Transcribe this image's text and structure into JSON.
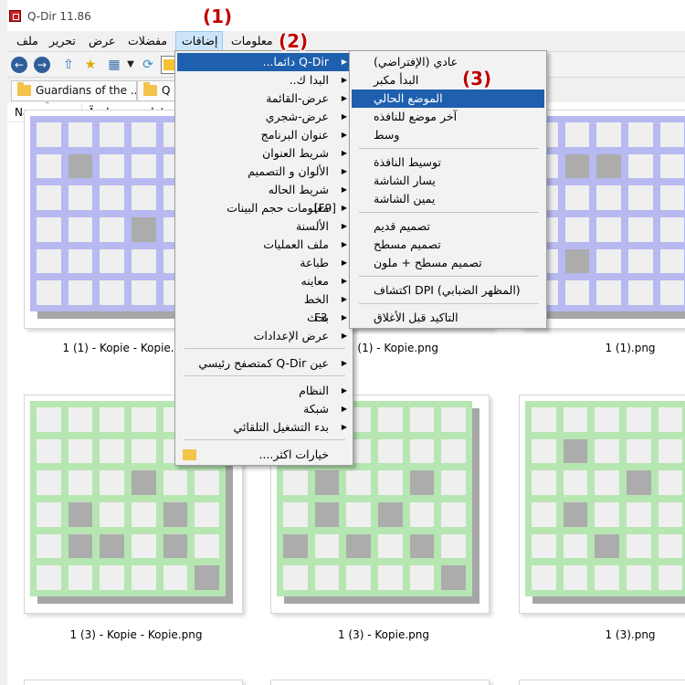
{
  "window": {
    "title": "Q-Dir 11.86"
  },
  "menubar": {
    "items": [
      "ملف",
      "تحرير",
      "عرض",
      "مفضلات",
      "إضافات",
      "معلومات"
    ],
    "active_index": 4
  },
  "annotations": [
    "(1)",
    "(2)",
    "(3)"
  ],
  "tabs": [
    {
      "label": "Guardians of the ..."
    },
    {
      "label": "Q"
    }
  ],
  "columns": {
    "name": "Name",
    "date": "Änderungsdatum"
  },
  "files": [
    {
      "label": "1 (1) - Kopie - Kopie.png",
      "color": "#b7b9f0"
    },
    {
      "label": "1 (1) - Kopie.png",
      "color": "#b7b9f0"
    },
    {
      "label": "1 (1).png",
      "color": "#b7b9f0"
    },
    {
      "label": "1 (3) - Kopie - Kopie.png",
      "color": "#b6e6b2"
    },
    {
      "label": "1 (3) - Kopie.png",
      "color": "#b6e6b2"
    },
    {
      "label": "1 (3).png",
      "color": "#b6e6b2"
    }
  ],
  "addons_menu": {
    "items": [
      {
        "label": "Q-Dir دائما...",
        "submenu": true,
        "highlighted": true
      },
      {
        "label": "البدا ك..",
        "submenu": true
      },
      {
        "label": "عرض-القائمة",
        "submenu": true
      },
      {
        "label": "عرض-شجري",
        "submenu": true
      },
      {
        "label": "عنوان البرنامج",
        "submenu": true
      },
      {
        "label": "شريط العنوان",
        "submenu": true
      },
      {
        "label": "الألوان و التصميم",
        "submenu": true
      },
      {
        "label": "شريط الحاله",
        "submenu": true
      },
      {
        "label": "معلومات حجم البينات",
        "submenu": true,
        "shortcut": "[F9]"
      },
      {
        "label": "الألسنة",
        "submenu": true
      },
      {
        "label": "ملف العمليات",
        "submenu": true
      },
      {
        "label": "طباعة",
        "submenu": true
      },
      {
        "label": "معاينه",
        "submenu": true
      },
      {
        "label": "الخط",
        "submenu": true
      },
      {
        "label": "بحث",
        "submenu": true,
        "shortcut": "F3"
      },
      {
        "label": "عرض الإعدادات",
        "submenu": true
      },
      {
        "label": "عين Q-Dir كمتصفح رئيسي",
        "submenu": true
      },
      {
        "label": "النظام",
        "submenu": true
      },
      {
        "label": "شبكة",
        "submenu": true
      },
      {
        "label": "بدء التشغيل التلقائي",
        "submenu": true
      },
      {
        "label": "خيارات اكثر....",
        "submenu": false
      }
    ]
  },
  "submenu": {
    "items": [
      "عادي (الإفتراضي)",
      "البدأ مكبر",
      "الموضع الحالي",
      "آخر موضع للنافذه",
      "وسط",
      "توسيط النافذة",
      "يسار الشاشة",
      "يمين الشاشة",
      "تصميم قديم",
      "تصميم مسطح",
      "تصميم مسطح + ملون",
      "(المظهر الضبابي) DPI اكتشاف",
      "التاكيد قبل الأغلاق"
    ],
    "highlighted_index": 2
  },
  "colors": {
    "menu_highlight": "#1e5fae",
    "menu_active": "#cce4f7",
    "annotation": "#c00000"
  }
}
